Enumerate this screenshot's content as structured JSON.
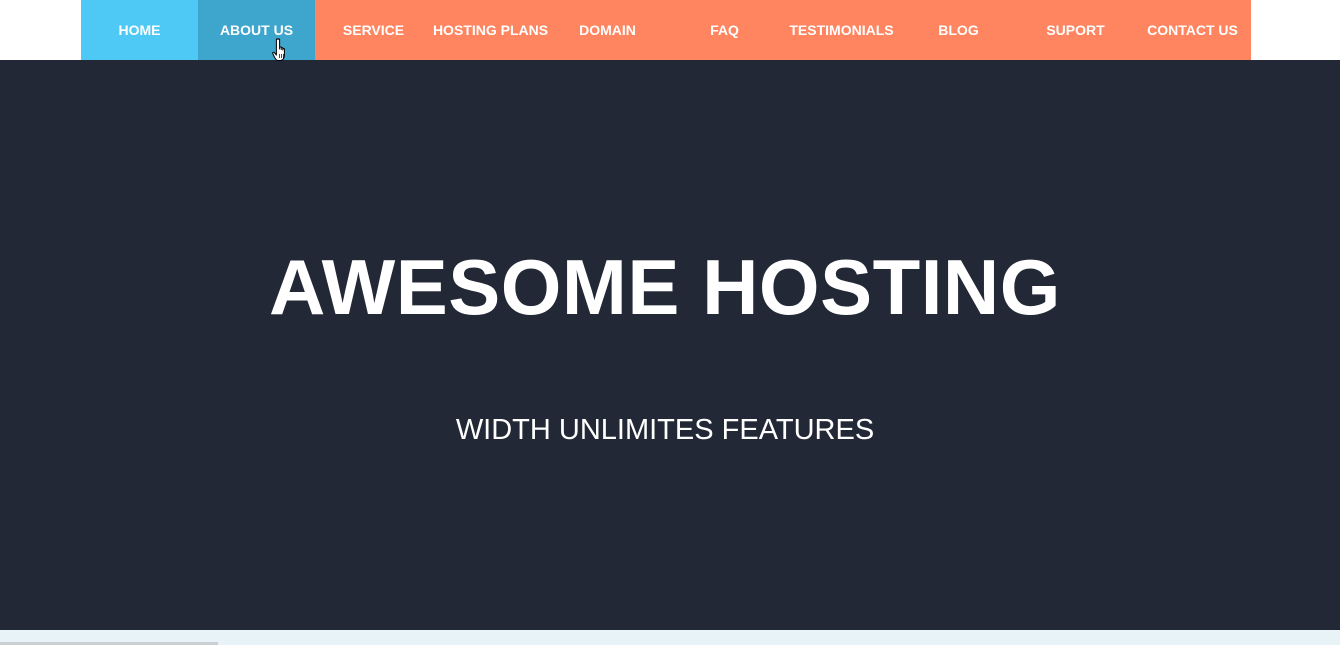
{
  "nav": {
    "items": [
      {
        "label": "HOME"
      },
      {
        "label": "ABOUT US"
      },
      {
        "label": "SERVICE"
      },
      {
        "label": "HOSTING PLANS"
      },
      {
        "label": "DOMAIN"
      },
      {
        "label": "FAQ"
      },
      {
        "label": "TESTIMONIALS"
      },
      {
        "label": "BLOG"
      },
      {
        "label": "SUPORT"
      },
      {
        "label": "CONTACT US"
      }
    ],
    "active_index": 0,
    "hover_index": 1
  },
  "hero": {
    "title": "AWESOME HOSTING",
    "subtitle": "WIDTH UNLIMITES FEATURES"
  },
  "colors": {
    "nav_bg": "#ff8560",
    "nav_active": "#4ec9f5",
    "nav_hover": "#3ea5cd",
    "hero_bg": "#232836",
    "footer_strip": "#e8f3f8"
  },
  "cursor": {
    "icon": "hand-pointer-icon"
  }
}
